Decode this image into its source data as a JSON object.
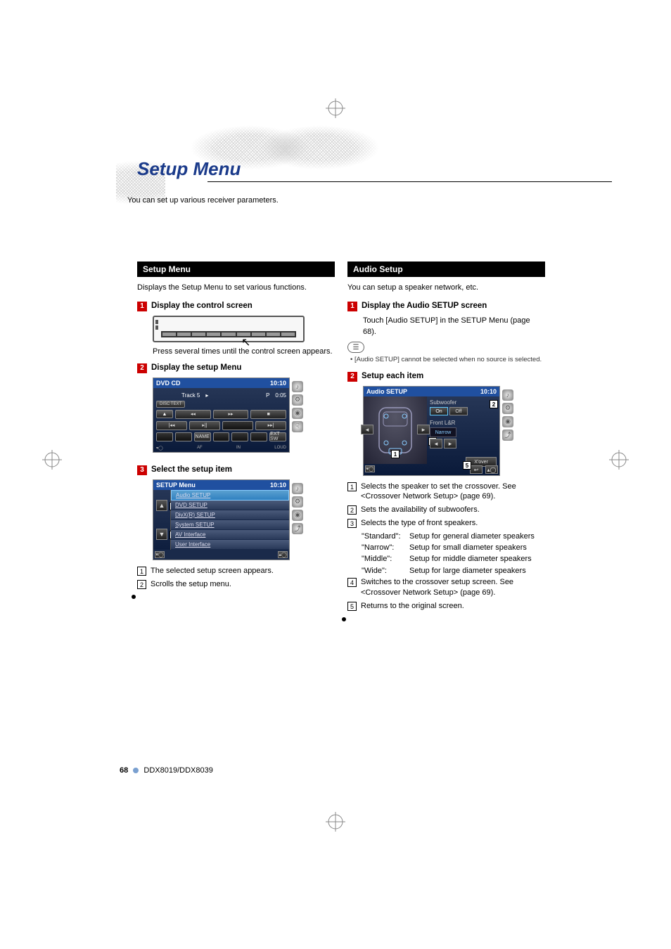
{
  "page": {
    "title": "Setup Menu",
    "subtitle": "You can set up various receiver parameters.",
    "number": "68",
    "model": "DDX8019/DDX8039"
  },
  "left": {
    "section_header": "Setup Menu",
    "section_desc": "Displays the Setup Menu to set various functions.",
    "step1_num": "1",
    "step1_title": "Display the control screen",
    "step1_note": "Press several times until the control screen appears.",
    "step2_num": "2",
    "step2_title": "Display the setup Menu",
    "dvd_screen": {
      "title": "DVD CD",
      "clock": "10:10",
      "track_label": "Track 5",
      "status": "P",
      "time": "0:05",
      "disc_text": "DISC TEXT",
      "buttons": {
        "eject": "▲",
        "rew": "◂◂",
        "fwd": "▸▸",
        "stop": "■",
        "prev": "|◂◂",
        "playpause": "▸||",
        "next": "▸▸|",
        "name": "NAME",
        "ext_sw": "EXT SW"
      },
      "footer": {
        "af": "AF",
        "in": "IN",
        "loud": "LOUD"
      }
    },
    "step3_num": "3",
    "step3_title": "Select the setup item",
    "setup_menu_screen": {
      "title": "SETUP Menu",
      "clock": "10:10",
      "items": [
        "Audio SETUP",
        "DVD SETUP",
        "DivX(R) SETUP",
        "System SETUP",
        "AV Interface",
        "User Interface"
      ]
    },
    "anno1": "The selected setup screen appears.",
    "anno2": "Scrolls the setup menu."
  },
  "right": {
    "section_header": "Audio Setup",
    "section_desc": "You can setup a speaker network, etc.",
    "step1_num": "1",
    "step1_title": "Display the Audio SETUP screen",
    "step1_note": "Touch [Audio SETUP] in the SETUP Menu (page 68).",
    "note_bullet": "•",
    "note_text": "[Audio SETUP] cannot be selected when no source is selected.",
    "step2_num": "2",
    "step2_title": "Setup each item",
    "audio_screen": {
      "title": "Audio SETUP",
      "clock": "10:10",
      "sub_label": "Subwoofer",
      "sub_on": "On",
      "sub_off": "Off",
      "front_label": "Front L&R",
      "front_value": "Narrow",
      "xover": "X'over"
    },
    "anno": [
      "Selects the speaker to set the crossover. See <Crossover Network Setup> (page 69).",
      "Sets the availability of subwoofers.",
      "Selects the type of front speakers.",
      "Switches to the crossover setup screen. See <Crossover Network Setup> (page 69).",
      "Returns to the original screen."
    ],
    "speakers": [
      {
        "key": "\"Standard\":",
        "val": "Setup for general diameter speakers"
      },
      {
        "key": "\"Narrow\":",
        "val": "Setup for small diameter speakers"
      },
      {
        "key": "\"Middle\":",
        "val": "Setup for middle diameter speakers"
      },
      {
        "key": "\"Wide\":",
        "val": "Setup for large diameter speakers"
      }
    ]
  }
}
